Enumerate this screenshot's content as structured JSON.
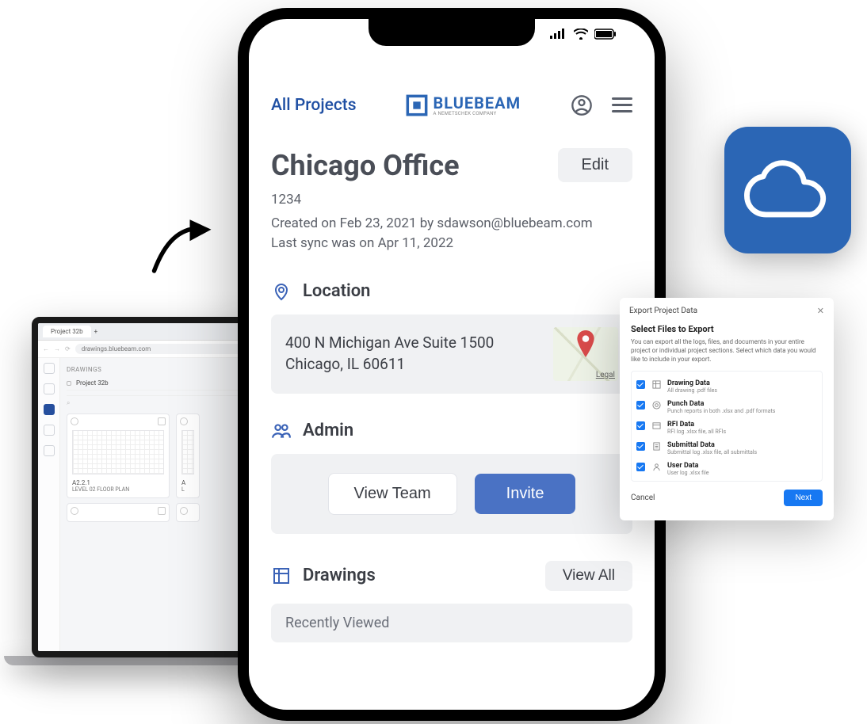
{
  "laptop": {
    "tab_title": "Project 32b",
    "url": "drawings.bluebeam.com",
    "sidebar_label": "DRAWINGS",
    "project_name": "Project 32b",
    "card": {
      "code": "A2.2.1",
      "title": "LEVEL 02 FLOOR PLAN"
    },
    "card2": {
      "code": "A",
      "title": "L"
    }
  },
  "cloud": {
    "name": "cloud"
  },
  "phone": {
    "header": {
      "all_projects": "All Projects",
      "brand": "BLUEBEAM",
      "brand_sub": "A NEMETSCHEK COMPANY"
    },
    "title": "Chicago Office",
    "edit_label": "Edit",
    "meta": {
      "id": "1234",
      "created": "Created on Feb 23, 2021 by sdawson@bluebeam.com",
      "sync": "Last sync was on Apr 11, 2022"
    },
    "location": {
      "label": "Location",
      "line1": "400 N Michigan Ave Suite 1500",
      "line2": "Chicago, IL 60611",
      "legal": "Legal"
    },
    "admin": {
      "label": "Admin",
      "view_team": "View Team",
      "invite": "Invite"
    },
    "drawings": {
      "label": "Drawings",
      "view_all": "View All",
      "recently_viewed": "Recently Viewed"
    }
  },
  "export_dialog": {
    "title": "Export Project Data",
    "subtitle": "Select Files to Export",
    "description": "You can export all the logs, files, and documents in your entire project or individual project sections. Select which data you would like to include in your export.",
    "items": [
      {
        "title": "Drawing Data",
        "subtitle": "All drawing .pdf files"
      },
      {
        "title": "Punch Data",
        "subtitle": "Punch reports in both .xlsx and .pdf formats"
      },
      {
        "title": "RFI Data",
        "subtitle": "RFI log .xlsx file, all RFIs"
      },
      {
        "title": "Submittal Data",
        "subtitle": "Submittal log .xlsx file, all submittals"
      },
      {
        "title": "User Data",
        "subtitle": "User log .xlsx file"
      }
    ],
    "cancel": "Cancel",
    "next": "Next"
  }
}
